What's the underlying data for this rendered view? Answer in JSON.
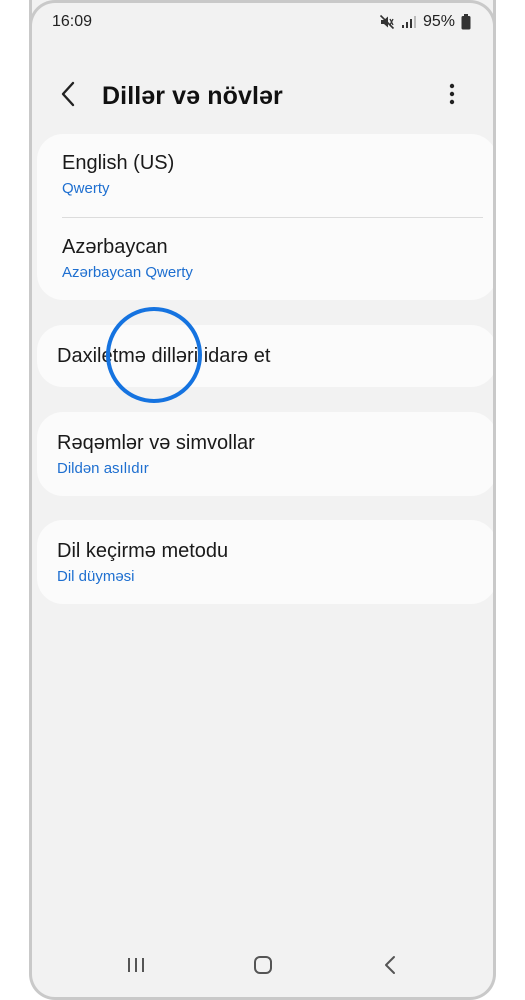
{
  "status_bar": {
    "time": "16:09",
    "battery": "95%",
    "icons": [
      "mute-icon",
      "signal-icon",
      "battery-icon"
    ]
  },
  "header": {
    "title": "Dillər və növlər",
    "back_icon": "chevron-left-icon",
    "more_icon": "more-vertical-icon"
  },
  "languages": [
    {
      "title": "English (US)",
      "subtitle": "Qwerty"
    },
    {
      "title": "Azərbaycan",
      "subtitle": "Azərbaycan Qwerty"
    }
  ],
  "manage_languages": {
    "title": "Daxiletmə dilləri idarə et"
  },
  "numbers_symbols": {
    "title": "Rəqəmlər və simvollar",
    "subtitle": "Dildən asılıdır"
  },
  "switch_method": {
    "title": "Dil keçirmə metodu",
    "subtitle": "Dil düyməsi"
  },
  "nav_bar": {
    "icons": [
      "recent-apps-icon",
      "home-icon",
      "back-icon"
    ]
  },
  "colors": {
    "accent": "#1e6fd0",
    "highlight_circle": "#1573e0",
    "background": "#f2f2f2",
    "card": "#fbfbfb"
  }
}
